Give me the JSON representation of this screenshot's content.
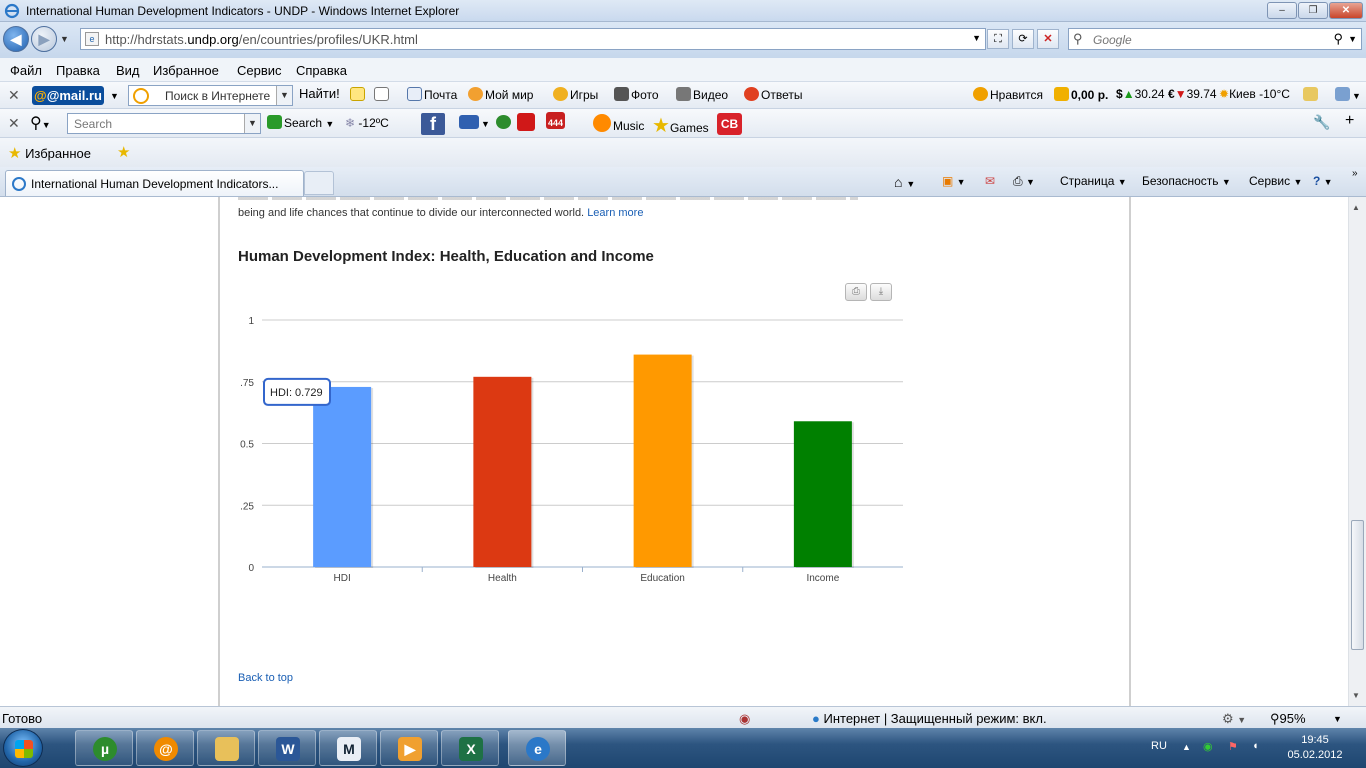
{
  "window": {
    "title": "International Human Development Indicators - UNDP - Windows Internet Explorer"
  },
  "address": {
    "url_prefix": "http://hdrstats.",
    "url_domain": "undp.org",
    "url_path": "/en/countries/profiles/UKR.html",
    "search_placeholder": "Google"
  },
  "menu": [
    "Файл",
    "Правка",
    "Вид",
    "Избранное",
    "Сервис",
    "Справка"
  ],
  "mailru_toolbar": {
    "logo": "@mail.ru",
    "search_placeholder": "Поиск в Интернете",
    "find_label": "Найти!",
    "items": [
      "Почта",
      "Мой мир",
      "Игры",
      "Фото",
      "Видео",
      "Ответы"
    ],
    "like_label": "Нравится",
    "balance": "0,00 р.",
    "usd": "30.24",
    "eur": "39.74",
    "weather": "Киев -10°C"
  },
  "second_toolbar": {
    "search_placeholder": "Search",
    "search_label": "Search",
    "temperature": "-12ºC",
    "badge_count": "444",
    "music_label": "Music",
    "games_label": "Games",
    "cb_label": "CB"
  },
  "favorites": {
    "label": "Избранное"
  },
  "tab": {
    "title": "International Human Development Indicators..."
  },
  "commands": {
    "page": "Страница",
    "safety": "Безопасность",
    "tools": "Сервис"
  },
  "page": {
    "intro_text": "being and life chances that continue to divide our interconnected world.",
    "learn_more": "Learn more",
    "chart_title": "Human Development Index: Health, Education and Income",
    "tooltip": "HDI: 0.729",
    "back_to_top": "Back to top"
  },
  "chart_data": {
    "type": "bar",
    "title": "Human Development Index: Health, Education and Income",
    "categories": [
      "HDI",
      "Health",
      "Education",
      "Income"
    ],
    "values": [
      0.729,
      0.77,
      0.86,
      0.59
    ],
    "colors": [
      "#5b9cff",
      "#dc3912",
      "#ff9900",
      "#008000"
    ],
    "yticks": [
      "0",
      ".25",
      "0.5",
      ".75",
      "1"
    ],
    "ylim": [
      0,
      1
    ],
    "grid": true
  },
  "status": {
    "ready": "Готово",
    "zone": "Интернет | Защищенный режим: вкл.",
    "zoom": "95%"
  },
  "taskbar": {
    "lang": "RU",
    "time": "19:45",
    "date": "05.02.2012"
  }
}
